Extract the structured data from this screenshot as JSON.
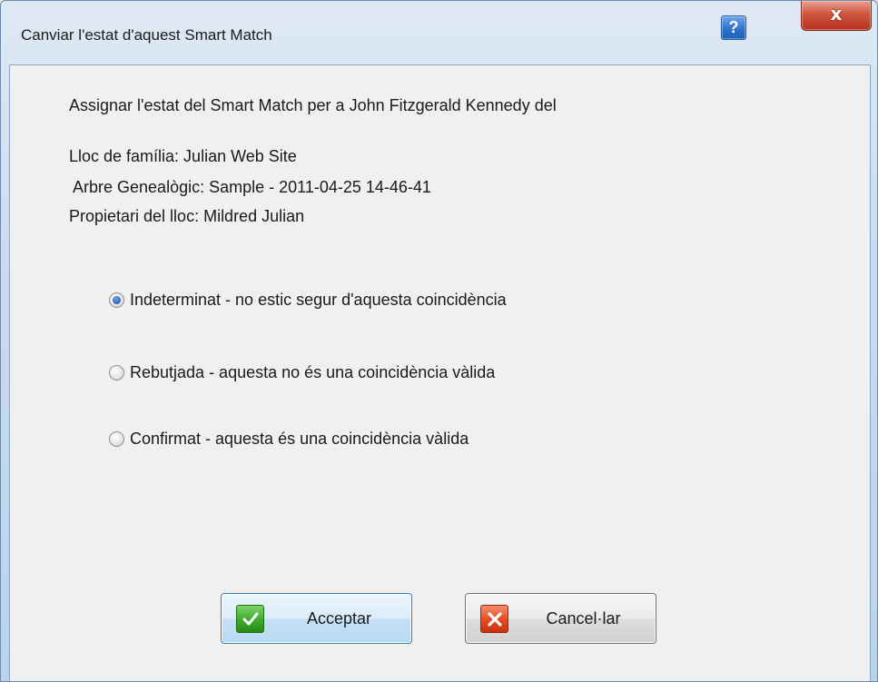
{
  "window": {
    "title": "Canviar l'estat d'aquest Smart Match",
    "help_label": "?",
    "close_label": "x"
  },
  "content": {
    "intro": "Assignar l'estat del Smart Match per a John Fitzgerald Kennedy del",
    "family_site": "Lloc de família: Julian Web Site",
    "family_tree": " Arbre Genealògic: Sample - 2011-04-25 14-46-41",
    "site_owner": "Propietari del lloc: Mildred Julian"
  },
  "options": [
    {
      "label": "Indeterminat - no estic segur d'aquesta coincidència",
      "checked": true
    },
    {
      "label": "Rebutjada - aquesta no és una coincidència vàlida",
      "checked": false
    },
    {
      "label": "Confirmat - aquesta és una coincidència vàlida",
      "checked": false
    }
  ],
  "buttons": {
    "ok_label": "Acceptar",
    "cancel_label": "Cancel·lar"
  },
  "icons": {
    "help": "help-icon",
    "close": "close-icon",
    "ok": "checkmark-icon",
    "cancel": "cross-icon"
  },
  "colors": {
    "ok_icon": "#3ea92c",
    "cancel_icon": "#e44a22",
    "help_button": "#2f74cf",
    "close_button": "#d0563f",
    "selected_radio": "#2a62b0"
  }
}
